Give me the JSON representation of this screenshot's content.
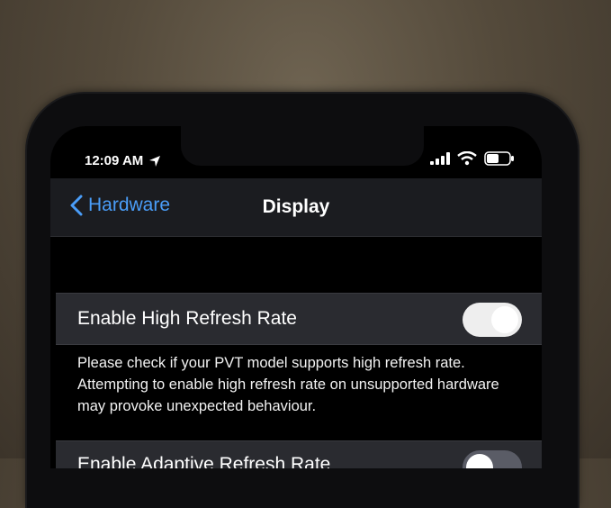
{
  "status_bar": {
    "time": "12:09 AM"
  },
  "nav": {
    "back_label": "Hardware",
    "title": "Display"
  },
  "settings": {
    "high_refresh": {
      "label": "Enable High Refresh Rate",
      "enabled": true
    },
    "footer_note": "Please check if your PVT model supports high refresh rate. Attempting to enable high refresh rate on unsupported hardware may provoke unexpected behaviour.",
    "adaptive_refresh": {
      "label": "Enable Adaptive Refresh Rate",
      "enabled": false
    }
  },
  "colors": {
    "accent": "#4a9df8",
    "toggle_off": "#5a5c66"
  }
}
